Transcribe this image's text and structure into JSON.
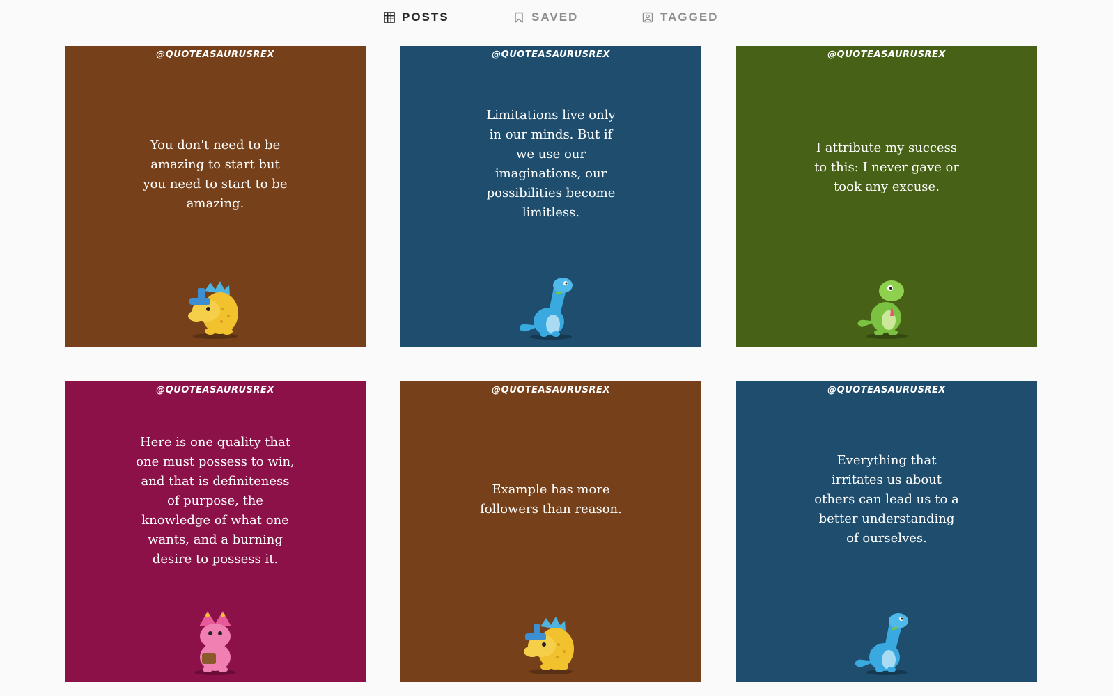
{
  "tabs": [
    {
      "label": "POSTS",
      "icon": "grid-icon",
      "active": true
    },
    {
      "label": "SAVED",
      "icon": "bookmark-icon",
      "active": false
    },
    {
      "label": "TAGGED",
      "icon": "tag-user-icon",
      "active": false
    }
  ],
  "posts": [
    {
      "handle": "@QUOTEASAURUSREX",
      "quote": "You don't need to be amazing to start but you need to start to be amazing.",
      "bg": "#76411a",
      "dino": "yellow-dinosaur-icon"
    },
    {
      "handle": "@QUOTEASAURUSREX",
      "quote": "Limitations live only in our minds. But if we use our imaginations, our possibilities become limitless.",
      "bg": "#1e4d6e",
      "dino": "blue-dinosaur-icon"
    },
    {
      "handle": "@QUOTEASAURUSREX",
      "quote": "I attribute my success to this: I never gave or took any excuse.",
      "bg": "#476217",
      "dino": "green-dinosaur-icon"
    },
    {
      "handle": "@QUOTEASAURUSREX",
      "quote": "Here is one quality that one must possess to win, and that is definiteness of purpose, the knowledge of what one wants, and a burning desire to possess it.",
      "bg": "#8c1148",
      "dino": "pink-dinosaur-icon"
    },
    {
      "handle": "@QUOTEASAURUSREX",
      "quote": "Example has more followers than reason.",
      "bg": "#76411a",
      "dino": "yellow-dinosaur-icon"
    },
    {
      "handle": "@QUOTEASAURUSREX",
      "quote": "Everything that irritates us about others can lead us to a better understanding of ourselves.",
      "bg": "#1e4d6e",
      "dino": "blue-dinosaur-icon"
    }
  ]
}
